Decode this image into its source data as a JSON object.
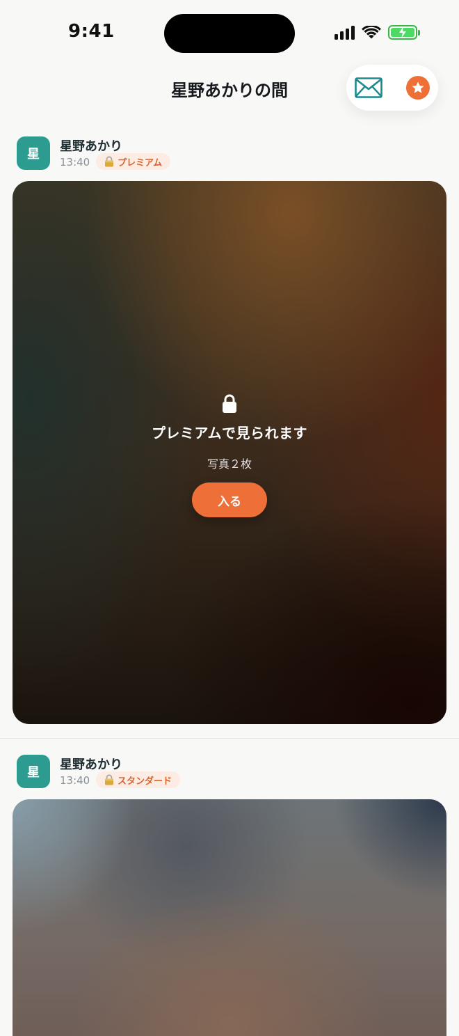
{
  "status_bar": {
    "time": "9:41"
  },
  "header": {
    "title": "星野あかりの間"
  },
  "icons": {
    "mail": "envelope-icon",
    "favorite": "star-icon",
    "lock": "lock-icon"
  },
  "colors": {
    "accent": "#ee7038",
    "avatar": "#2c9c90",
    "mail_icon": "#1a8a8c",
    "badge_bg": "#fdece3",
    "badge_text": "#d8642c"
  },
  "posts": [
    {
      "avatar_label": "星",
      "author": "星野あかり",
      "time": "13:40",
      "tier": "プレミアム",
      "locked_title": "プレミアムで見られます",
      "locked_sub": "写真２枚",
      "enter_label": "入る"
    },
    {
      "avatar_label": "星",
      "author": "星野あかり",
      "time": "13:40",
      "tier": "スタンダード"
    }
  ]
}
